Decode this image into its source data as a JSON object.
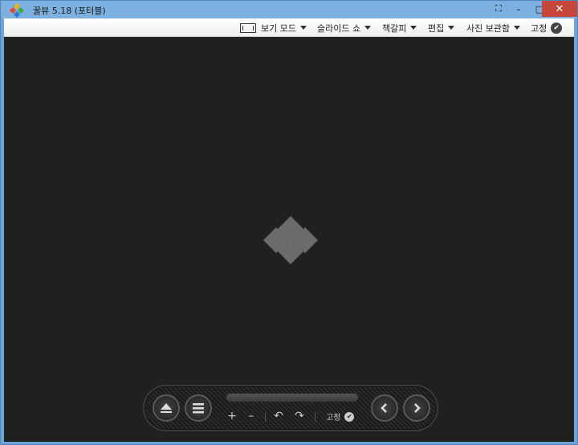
{
  "window": {
    "title": "꿀뷰 5.18 (포터블)",
    "buttons": {
      "special": "⛶",
      "minimize": "–",
      "maximize": "□",
      "close": "✕"
    }
  },
  "menubar": {
    "items": [
      {
        "label": "보기 모드",
        "icon": "view-mode-icon"
      },
      {
        "label": "슬라이드 쇼"
      },
      {
        "label": "책갈피"
      },
      {
        "label": "편집"
      },
      {
        "label": "사진 보관함"
      }
    ],
    "pin_label": "고정"
  },
  "controls": {
    "zoom_in": "+",
    "zoom_out": "–",
    "rotate_left": "↶",
    "rotate_right": "↷",
    "pin_label": "고정",
    "prev": "‹",
    "next": "›"
  },
  "colors": {
    "title_bar": "#7cb0e0",
    "close_red": "#c7463b",
    "viewer_bg": "#202020",
    "logo_gray": "#6b6b6b"
  }
}
